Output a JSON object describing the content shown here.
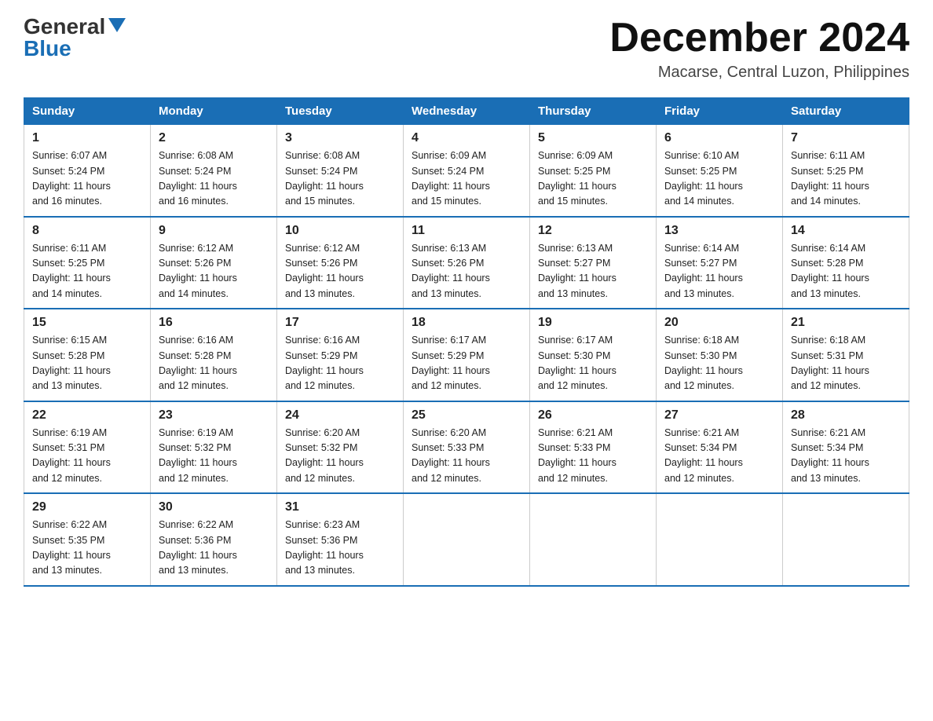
{
  "logo": {
    "general": "General",
    "blue": "Blue"
  },
  "header": {
    "month_year": "December 2024",
    "location": "Macarse, Central Luzon, Philippines"
  },
  "days_of_week": [
    "Sunday",
    "Monday",
    "Tuesday",
    "Wednesday",
    "Thursday",
    "Friday",
    "Saturday"
  ],
  "weeks": [
    [
      {
        "day": "1",
        "sunrise": "6:07 AM",
        "sunset": "5:24 PM",
        "daylight": "11 hours and 16 minutes."
      },
      {
        "day": "2",
        "sunrise": "6:08 AM",
        "sunset": "5:24 PM",
        "daylight": "11 hours and 16 minutes."
      },
      {
        "day": "3",
        "sunrise": "6:08 AM",
        "sunset": "5:24 PM",
        "daylight": "11 hours and 15 minutes."
      },
      {
        "day": "4",
        "sunrise": "6:09 AM",
        "sunset": "5:24 PM",
        "daylight": "11 hours and 15 minutes."
      },
      {
        "day": "5",
        "sunrise": "6:09 AM",
        "sunset": "5:25 PM",
        "daylight": "11 hours and 15 minutes."
      },
      {
        "day": "6",
        "sunrise": "6:10 AM",
        "sunset": "5:25 PM",
        "daylight": "11 hours and 14 minutes."
      },
      {
        "day": "7",
        "sunrise": "6:11 AM",
        "sunset": "5:25 PM",
        "daylight": "11 hours and 14 minutes."
      }
    ],
    [
      {
        "day": "8",
        "sunrise": "6:11 AM",
        "sunset": "5:25 PM",
        "daylight": "11 hours and 14 minutes."
      },
      {
        "day": "9",
        "sunrise": "6:12 AM",
        "sunset": "5:26 PM",
        "daylight": "11 hours and 14 minutes."
      },
      {
        "day": "10",
        "sunrise": "6:12 AM",
        "sunset": "5:26 PM",
        "daylight": "11 hours and 13 minutes."
      },
      {
        "day": "11",
        "sunrise": "6:13 AM",
        "sunset": "5:26 PM",
        "daylight": "11 hours and 13 minutes."
      },
      {
        "day": "12",
        "sunrise": "6:13 AM",
        "sunset": "5:27 PM",
        "daylight": "11 hours and 13 minutes."
      },
      {
        "day": "13",
        "sunrise": "6:14 AM",
        "sunset": "5:27 PM",
        "daylight": "11 hours and 13 minutes."
      },
      {
        "day": "14",
        "sunrise": "6:14 AM",
        "sunset": "5:28 PM",
        "daylight": "11 hours and 13 minutes."
      }
    ],
    [
      {
        "day": "15",
        "sunrise": "6:15 AM",
        "sunset": "5:28 PM",
        "daylight": "11 hours and 13 minutes."
      },
      {
        "day": "16",
        "sunrise": "6:16 AM",
        "sunset": "5:28 PM",
        "daylight": "11 hours and 12 minutes."
      },
      {
        "day": "17",
        "sunrise": "6:16 AM",
        "sunset": "5:29 PM",
        "daylight": "11 hours and 12 minutes."
      },
      {
        "day": "18",
        "sunrise": "6:17 AM",
        "sunset": "5:29 PM",
        "daylight": "11 hours and 12 minutes."
      },
      {
        "day": "19",
        "sunrise": "6:17 AM",
        "sunset": "5:30 PM",
        "daylight": "11 hours and 12 minutes."
      },
      {
        "day": "20",
        "sunrise": "6:18 AM",
        "sunset": "5:30 PM",
        "daylight": "11 hours and 12 minutes."
      },
      {
        "day": "21",
        "sunrise": "6:18 AM",
        "sunset": "5:31 PM",
        "daylight": "11 hours and 12 minutes."
      }
    ],
    [
      {
        "day": "22",
        "sunrise": "6:19 AM",
        "sunset": "5:31 PM",
        "daylight": "11 hours and 12 minutes."
      },
      {
        "day": "23",
        "sunrise": "6:19 AM",
        "sunset": "5:32 PM",
        "daylight": "11 hours and 12 minutes."
      },
      {
        "day": "24",
        "sunrise": "6:20 AM",
        "sunset": "5:32 PM",
        "daylight": "11 hours and 12 minutes."
      },
      {
        "day": "25",
        "sunrise": "6:20 AM",
        "sunset": "5:33 PM",
        "daylight": "11 hours and 12 minutes."
      },
      {
        "day": "26",
        "sunrise": "6:21 AM",
        "sunset": "5:33 PM",
        "daylight": "11 hours and 12 minutes."
      },
      {
        "day": "27",
        "sunrise": "6:21 AM",
        "sunset": "5:34 PM",
        "daylight": "11 hours and 12 minutes."
      },
      {
        "day": "28",
        "sunrise": "6:21 AM",
        "sunset": "5:34 PM",
        "daylight": "11 hours and 13 minutes."
      }
    ],
    [
      {
        "day": "29",
        "sunrise": "6:22 AM",
        "sunset": "5:35 PM",
        "daylight": "11 hours and 13 minutes."
      },
      {
        "day": "30",
        "sunrise": "6:22 AM",
        "sunset": "5:36 PM",
        "daylight": "11 hours and 13 minutes."
      },
      {
        "day": "31",
        "sunrise": "6:23 AM",
        "sunset": "5:36 PM",
        "daylight": "11 hours and 13 minutes."
      },
      null,
      null,
      null,
      null
    ]
  ],
  "labels": {
    "sunrise": "Sunrise:",
    "sunset": "Sunset:",
    "daylight": "Daylight:"
  }
}
